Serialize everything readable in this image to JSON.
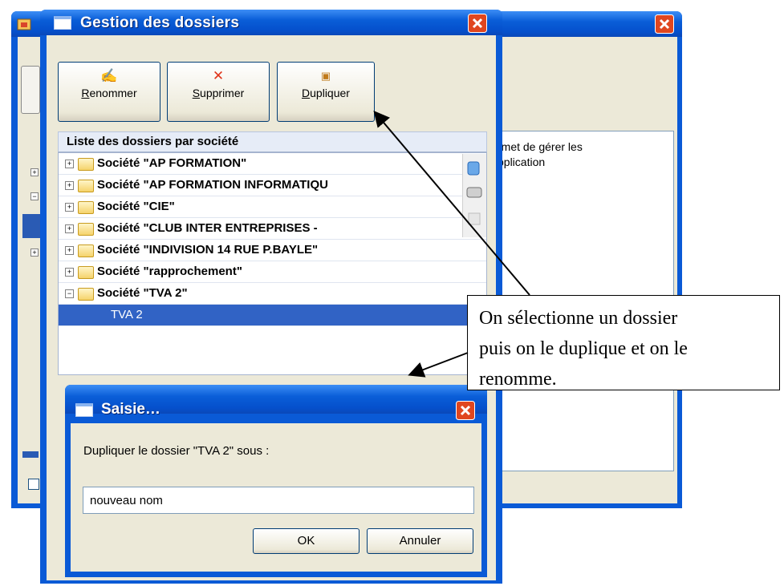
{
  "background_window": {
    "description_lines": [
      "rmet de gérer les",
      "pplication"
    ]
  },
  "dialog": {
    "title": "Gestion des dossiers",
    "toolbar": {
      "rename": {
        "icon": "✍",
        "accel": "R",
        "rest": "enommer"
      },
      "delete": {
        "icon": "✕",
        "accel": "S",
        "rest": "upprimer"
      },
      "duplicate": {
        "icon": "▣",
        "accel": "D",
        "rest": "upliquer"
      }
    },
    "list_header": "Liste des dossiers par société",
    "tree": [
      {
        "expander": "+",
        "label": "Société \"AP FORMATION\""
      },
      {
        "expander": "+",
        "label": "Société \"AP FORMATION INFORMATIQU"
      },
      {
        "expander": "+",
        "label": "Société \"CIE\""
      },
      {
        "expander": "+",
        "label": "Société \"CLUB INTER ENTREPRISES -"
      },
      {
        "expander": "+",
        "label": "Société \"INDIVISION 14 RUE P.BAYLE\""
      },
      {
        "expander": "+",
        "label": "Société \"rapprochement\""
      },
      {
        "expander": "−",
        "label": "Société \"TVA 2\""
      }
    ],
    "selected_item": "TVA 2"
  },
  "saisie": {
    "title": "Saisie…",
    "prompt": "Dupliquer le dossier \"TVA 2\" sous :",
    "input_value": "nouveau nom",
    "ok_label": "OK",
    "cancel_label": "Annuler"
  },
  "annotation": {
    "lines": [
      "On sélectionne un dossier",
      "puis on le duplique et on le",
      "renomme."
    ]
  },
  "colors": {
    "titlebar": "#0a5ed8",
    "close_red": "#e0461f",
    "selection": "#3163c5",
    "dialog_face": "#ece9d8"
  }
}
